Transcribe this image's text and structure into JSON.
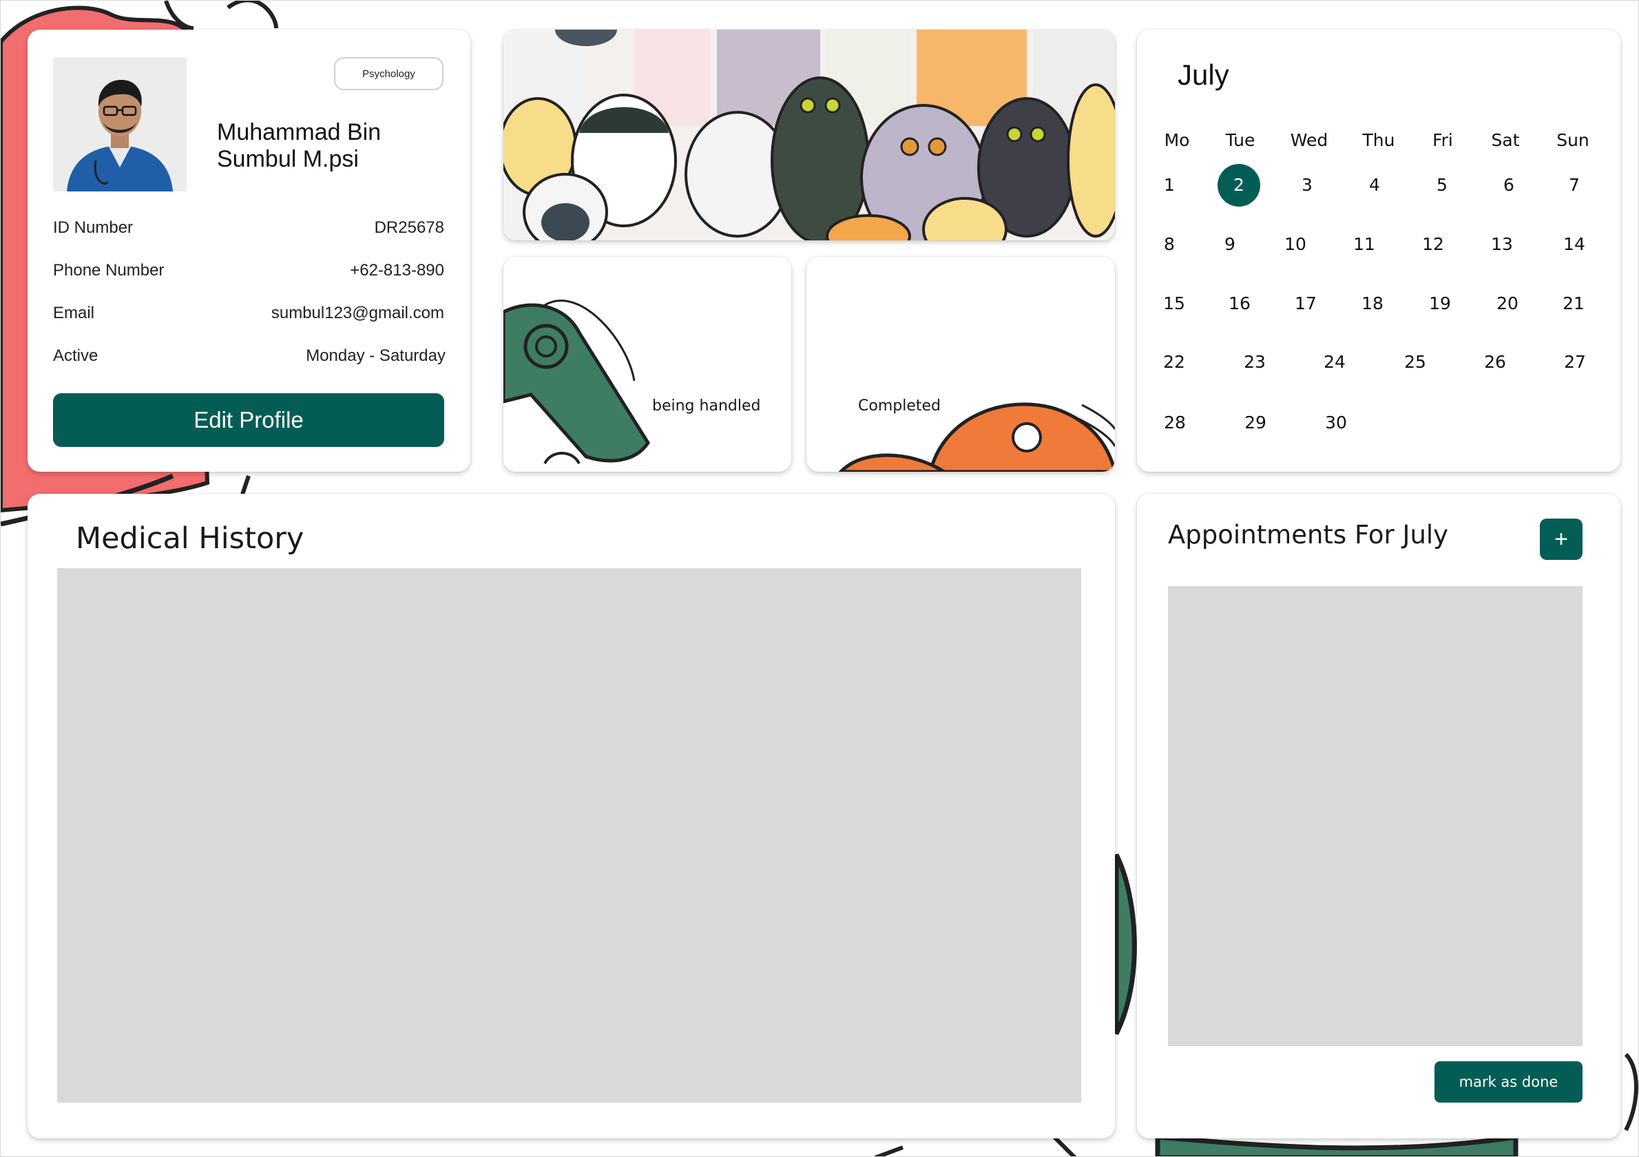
{
  "profile": {
    "specialty": "Psychology",
    "name_line1": "Muhammad Bin",
    "name_line2": "Sumbul M.psi",
    "rows": [
      {
        "label": "ID Number",
        "value": "DR25678"
      },
      {
        "label": "Phone Number",
        "value": "+62-813-890"
      },
      {
        "label": "Email",
        "value": "sumbul123@gmail.com"
      },
      {
        "label": "Active",
        "value": "Monday - Saturday"
      }
    ],
    "edit_label": "Edit Profile"
  },
  "status": {
    "handled_label": "being handled",
    "completed_label": "Completed"
  },
  "calendar": {
    "month": "July",
    "weekdays": [
      "Mo",
      "Tue",
      "Wed",
      "Thu",
      "Fri",
      "Sat",
      "Sun"
    ],
    "selected_day": "2",
    "weeks": [
      [
        "1",
        "2",
        "3",
        "4",
        "5",
        "6",
        "7"
      ],
      [
        "8",
        "9",
        "10",
        "11",
        "12",
        "13",
        "14"
      ],
      [
        "15",
        "16",
        "17",
        "18",
        "19",
        "20",
        "21"
      ],
      [
        "22",
        "23",
        "24",
        "25",
        "26",
        "27"
      ],
      [
        "28",
        "29",
        "30"
      ]
    ]
  },
  "history": {
    "title": "Medical History"
  },
  "appointments": {
    "title": "Appointments For July",
    "add_label": "+",
    "done_label": "mark as done"
  },
  "colors": {
    "accent": "#045d55",
    "panel": "#d9d9d9",
    "deco_red": "#f26d6d",
    "deco_green": "#3e7d64",
    "deco_orange": "#f07a3a"
  }
}
